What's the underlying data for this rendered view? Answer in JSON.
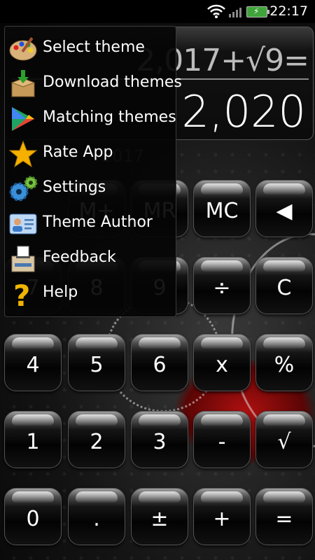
{
  "status": {
    "time": "22:17"
  },
  "display": {
    "expression": "2,017+√9=",
    "result": "2,020",
    "memory": "2017"
  },
  "menu": {
    "items": [
      {
        "label": "Select theme",
        "icon": "palette-icon"
      },
      {
        "label": "Download themes",
        "icon": "download-box-icon"
      },
      {
        "label": "Matching themes",
        "icon": "play-store-icon"
      },
      {
        "label": "Rate App",
        "icon": "star-icon"
      },
      {
        "label": "Settings",
        "icon": "gears-icon"
      },
      {
        "label": "Theme Author",
        "icon": "id-card-icon"
      },
      {
        "label": "Feedback",
        "icon": "ballot-box-icon"
      },
      {
        "label": "Help",
        "icon": "question-mark-icon"
      }
    ]
  },
  "keys": {
    "mplus": "M+",
    "mr": "MR",
    "mc": "MC",
    "backspace": "◀",
    "seven": "7",
    "eight": "8",
    "nine": "9",
    "divide": "÷",
    "clear": "C",
    "four": "4",
    "five": "5",
    "six": "6",
    "multiply": "x",
    "percent": "%",
    "one": "1",
    "two": "2",
    "three": "3",
    "minus": "-",
    "sqrt": "√",
    "zero": "0",
    "dot": ".",
    "plusminus": "±",
    "plus": "+",
    "equals": "="
  },
  "colors": {
    "battery": "#3fa43a",
    "accent_red": "#b01010",
    "star": "#f5b000",
    "help": "#f0b400"
  }
}
